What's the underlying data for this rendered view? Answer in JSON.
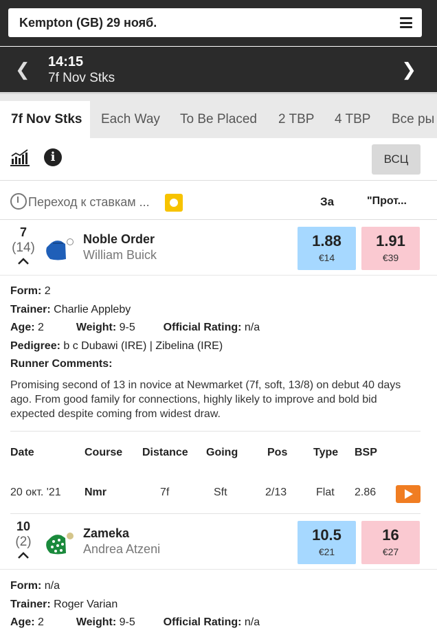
{
  "header": {
    "venue_title": "Kempton (GB) 29 нояб.",
    "race_time": "14:15",
    "race_name": "7f Nov Stks"
  },
  "tabs": [
    {
      "label": "7f Nov Stks",
      "active": true
    },
    {
      "label": "Each Way"
    },
    {
      "label": "To Be Placed"
    },
    {
      "label": "2 TBP"
    },
    {
      "label": "4 TBP"
    },
    {
      "label": "Все ры"
    }
  ],
  "toolbar": {
    "chart_icon": "bar-chart-icon",
    "info_icon": "info-icon",
    "info_glyph": "i",
    "vsc_label": "ВСЦ"
  },
  "bet_header": {
    "goto_label": "Переход к ставкам ...",
    "back_label": "За",
    "lay_label": "\"Прот..."
  },
  "colors": {
    "back": "#a6d8ff",
    "lay": "#fac9d1",
    "live": "#f7c300",
    "video": "#f07d22"
  },
  "runners": [
    {
      "number": "7",
      "draw": "(14)",
      "horse": "Noble Order",
      "jockey": "William Buick",
      "back_price": "1.88",
      "back_stake": "€14",
      "lay_price": "1.91",
      "lay_stake": "€39",
      "silk_color": "#1f5fb8",
      "details": {
        "form_label": "Form:",
        "form": "2",
        "trainer_label": "Trainer:",
        "trainer": "Charlie Appleby",
        "age_label": "Age:",
        "age": "2",
        "weight_label": "Weight:",
        "weight": "9-5",
        "rating_label": "Official Rating:",
        "rating": "n/a",
        "pedigree_label": "Pedigree:",
        "pedigree": "b c Dubawi (IRE) | Zibelina (IRE)",
        "comments_label": "Runner Comments:",
        "comments": "Promising second of 13 in novice at Newmarket (7f, soft, 13/8) on debut 40 days ago. From good family for connections, highly likely to improve and bold bid expected despite coming from widest draw."
      },
      "form_table": {
        "headers": [
          "Date",
          "Course",
          "Distance",
          "Going",
          "Pos",
          "Type",
          "BSP"
        ],
        "rows": [
          [
            "20 окт. '21",
            "Nmr",
            "7f",
            "Sft",
            "2/13",
            "Flat",
            "2.86"
          ]
        ]
      }
    },
    {
      "number": "10",
      "draw": "(2)",
      "horse": "Zameka",
      "jockey": "Andrea Atzeni",
      "back_price": "10.5",
      "back_stake": "€21",
      "lay_price": "16",
      "lay_stake": "€27",
      "silk_color": "#1a8a3c",
      "details": {
        "form_label": "Form:",
        "form": "n/a",
        "trainer_label": "Trainer:",
        "trainer": "Roger Varian",
        "age_label": "Age:",
        "age": "2",
        "weight_label": "Weight:",
        "weight": "9-5",
        "rating_label": "Official Rating:",
        "rating": "n/a"
      }
    }
  ]
}
